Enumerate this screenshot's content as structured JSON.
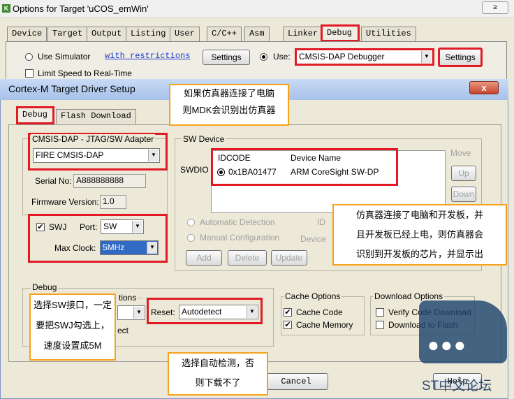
{
  "outer": {
    "title": "Options for Target 'uCOS_emWin'",
    "close_label": "≥",
    "tabs": [
      "Device",
      "Target",
      "Output",
      "Listing",
      "User",
      "C/C++",
      "Asm",
      "Linker",
      "Debug",
      "Utilities"
    ],
    "use_simulator": "Use Simulator",
    "with_restrictions": "with restrictions",
    "settings_left": "Settings",
    "use_label": "Use:",
    "debugger": "CMSIS-DAP Debugger",
    "settings_right": "Settings",
    "limit_speed": "Limit Speed to Real-Time"
  },
  "inner": {
    "title": "Cortex-M Target Driver Setup",
    "close_label": "x",
    "tabs": [
      "Debug",
      "Flash Download"
    ],
    "adapter_group": "CMSIS-DAP - JTAG/SW Adapter",
    "adapter": "FIRE CMSIS-DAP",
    "serial_label": "Serial No:",
    "serial_value": "A888888888",
    "firmware_label": "Firmware Version:",
    "firmware_value": "1.0",
    "swj_label": "SWJ",
    "port_label": "Port:",
    "port_value": "SW",
    "max_clock_label": "Max Clock:",
    "max_clock_value": "5MHz",
    "sw_device_group": "SW Device",
    "move_label": "Move",
    "up_label": "Up",
    "down_label": "Down",
    "swdio_label": "SWDIO",
    "idcode_header": "IDCODE",
    "device_name_header": "Device Name",
    "idcode_value": "0x1BA01477",
    "device_name_value": "ARM CoreSight SW-DP",
    "auto_detect": "Automatic Detection",
    "manual_config": "Manual Configuration",
    "id_label": "ID",
    "device_label": "Device",
    "add_label": "Add",
    "delete_label": "Delete",
    "update_label": "Update",
    "debug_group": "Debug",
    "options_group_partial": "tions",
    "ect_partial": "ect",
    "reset_label": "Reset:",
    "reset_value": "Autodetect",
    "cache_group": "Cache Options",
    "cache_code": "Cache Code",
    "cache_memory": "Cache Memory",
    "download_group": "Download Options",
    "verify_code": "Verify Code Download",
    "download_to_flash": "Download to Flash",
    "cancel_label": "Cancel",
    "help_partial": "Help"
  },
  "callouts": {
    "top": [
      "如果仿真器连接了电脑",
      "则MDK会识别出仿真器"
    ],
    "right": [
      "仿真器连接了电脑和开发板，并",
      "且开发板已经上电，则仿真器会",
      "识别到开发板的芯片，并显示出"
    ],
    "left": [
      "选择SW接口，一定",
      "要把SWJ勾选上，",
      "速度设置成5M"
    ],
    "bottom": [
      "选择自动检测，否",
      "则下载不了"
    ]
  },
  "watermark": "ST中文论坛"
}
